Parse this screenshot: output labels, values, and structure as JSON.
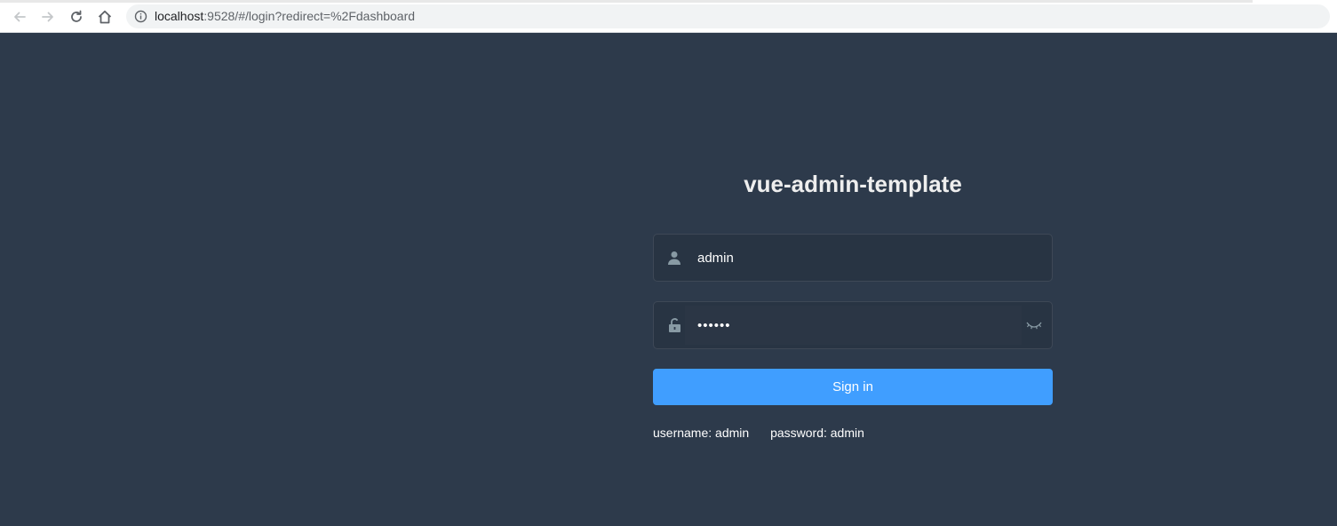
{
  "browser": {
    "url_host": "localhost",
    "url_rest": ":9528/#/login?redirect=%2Fdashboard",
    "icons": [
      "back-arrow-icon",
      "forward-arrow-icon",
      "reload-icon",
      "home-icon",
      "info-icon"
    ]
  },
  "login": {
    "title": "vue-admin-template",
    "username_value": "admin",
    "password_value": "••••••",
    "signin_label": "Sign in",
    "tip_username": "username: admin",
    "tip_password": "password: admin"
  },
  "colors": {
    "background": "#2d3a4b",
    "accent": "#409eff",
    "title": "#eeeeee",
    "icon": "#889aa4"
  }
}
